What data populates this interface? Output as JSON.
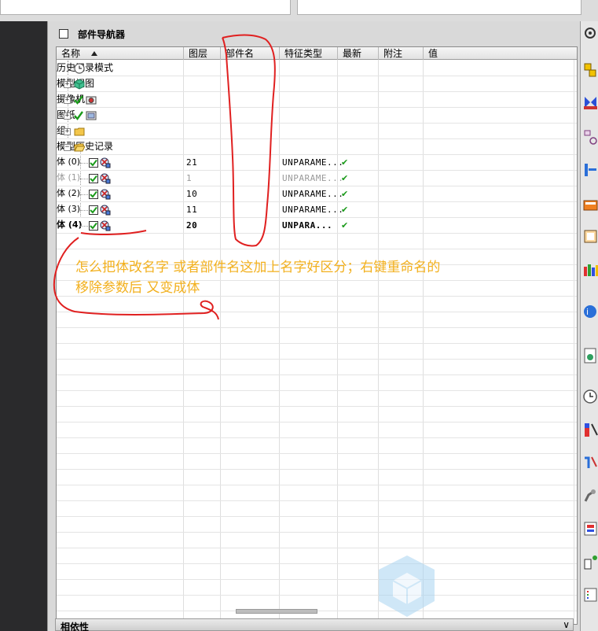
{
  "panel": {
    "title": "部件导航器",
    "dependencies_label": "相依性"
  },
  "columns": [
    {
      "key": "name",
      "label": "名称"
    },
    {
      "key": "layer",
      "label": "图层"
    },
    {
      "key": "part_name",
      "label": "部件名"
    },
    {
      "key": "feature_type",
      "label": "特征类型"
    },
    {
      "key": "latest",
      "label": "最新"
    },
    {
      "key": "attach",
      "label": "附注"
    },
    {
      "key": "value",
      "label": "值"
    }
  ],
  "tree": [
    {
      "label": "历史记录模式",
      "icon": "clock-icon"
    },
    {
      "label": "模型视图",
      "icon": "model-view-icon"
    },
    {
      "label": "摄像机",
      "icon": "camera-icon"
    },
    {
      "label": "图纸",
      "icon": "drawing-icon"
    },
    {
      "label": "组",
      "icon": "folder-icon"
    },
    {
      "label": "模型历史记录",
      "icon": "folder-open-icon"
    },
    {
      "label": "体 (0)",
      "layer": "21",
      "feature_type": "UNPARAME...",
      "latest": "✔"
    },
    {
      "label": "体 (1)",
      "layer": "1",
      "feature_type": "UNPARAME...",
      "latest": "✔"
    },
    {
      "label": "体 (2)",
      "layer": "10",
      "feature_type": "UNPARAME...",
      "latest": "✔"
    },
    {
      "label": "体 (3)",
      "layer": "11",
      "feature_type": "UNPARAME...",
      "latest": "✔"
    },
    {
      "label": "体 (4)",
      "layer": "20",
      "feature_type": "UNPARA...",
      "latest": "✔"
    }
  ],
  "annotation": {
    "line1": "怎么把体改名字 或者部件名这加上名字好区分；右键重命名的",
    "line2": "移除参数后 又变成体"
  },
  "colors": {
    "annotation_text": "#f2b01e",
    "annotation_ink": "#e02020",
    "check_green": "#1a9a1a"
  }
}
